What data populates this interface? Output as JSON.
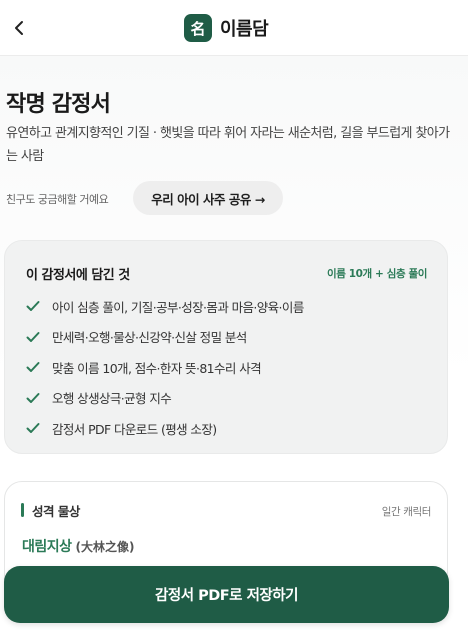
{
  "header": {
    "back_icon": "chevron-left-icon",
    "logo_glyph": "名",
    "brand_name": "이름담"
  },
  "report": {
    "title": "작명 감정서",
    "subtitle": "유연하고 관계지향적인 기질 · 햇빛을 따라 휘어 자라는 새순처럼, 길을 부드럽게 찾아가는 사람"
  },
  "share": {
    "hint": "친구도 궁금해할 거예요",
    "button_label": "우리 아이 사주 공유 →"
  },
  "contents_card": {
    "title": "이 감정서에 담긴 것",
    "meta": "이름 10개 + 심층 풀이",
    "items": [
      "아이 심층 풀이, 기질·공부·성장·몸과 마음·양육·이름",
      "만세력·오행·물상·신강약·신살 정밀 분석",
      "맞춤 이름 10개, 점수·한자 뜻·81수리 사격",
      "오행 상생상극·균형 지수",
      "감정서 PDF 다운로드 (평생 소장)"
    ]
  },
  "personality_card": {
    "label": "성격 물상",
    "meta": "일간 캐릭터",
    "value": "대림지상",
    "hanja": "(大林之像)"
  },
  "cta": {
    "label": "감정서 PDF로 저장하기"
  },
  "colors": {
    "brand": "#1f5c46",
    "accent": "#2b7a57"
  }
}
